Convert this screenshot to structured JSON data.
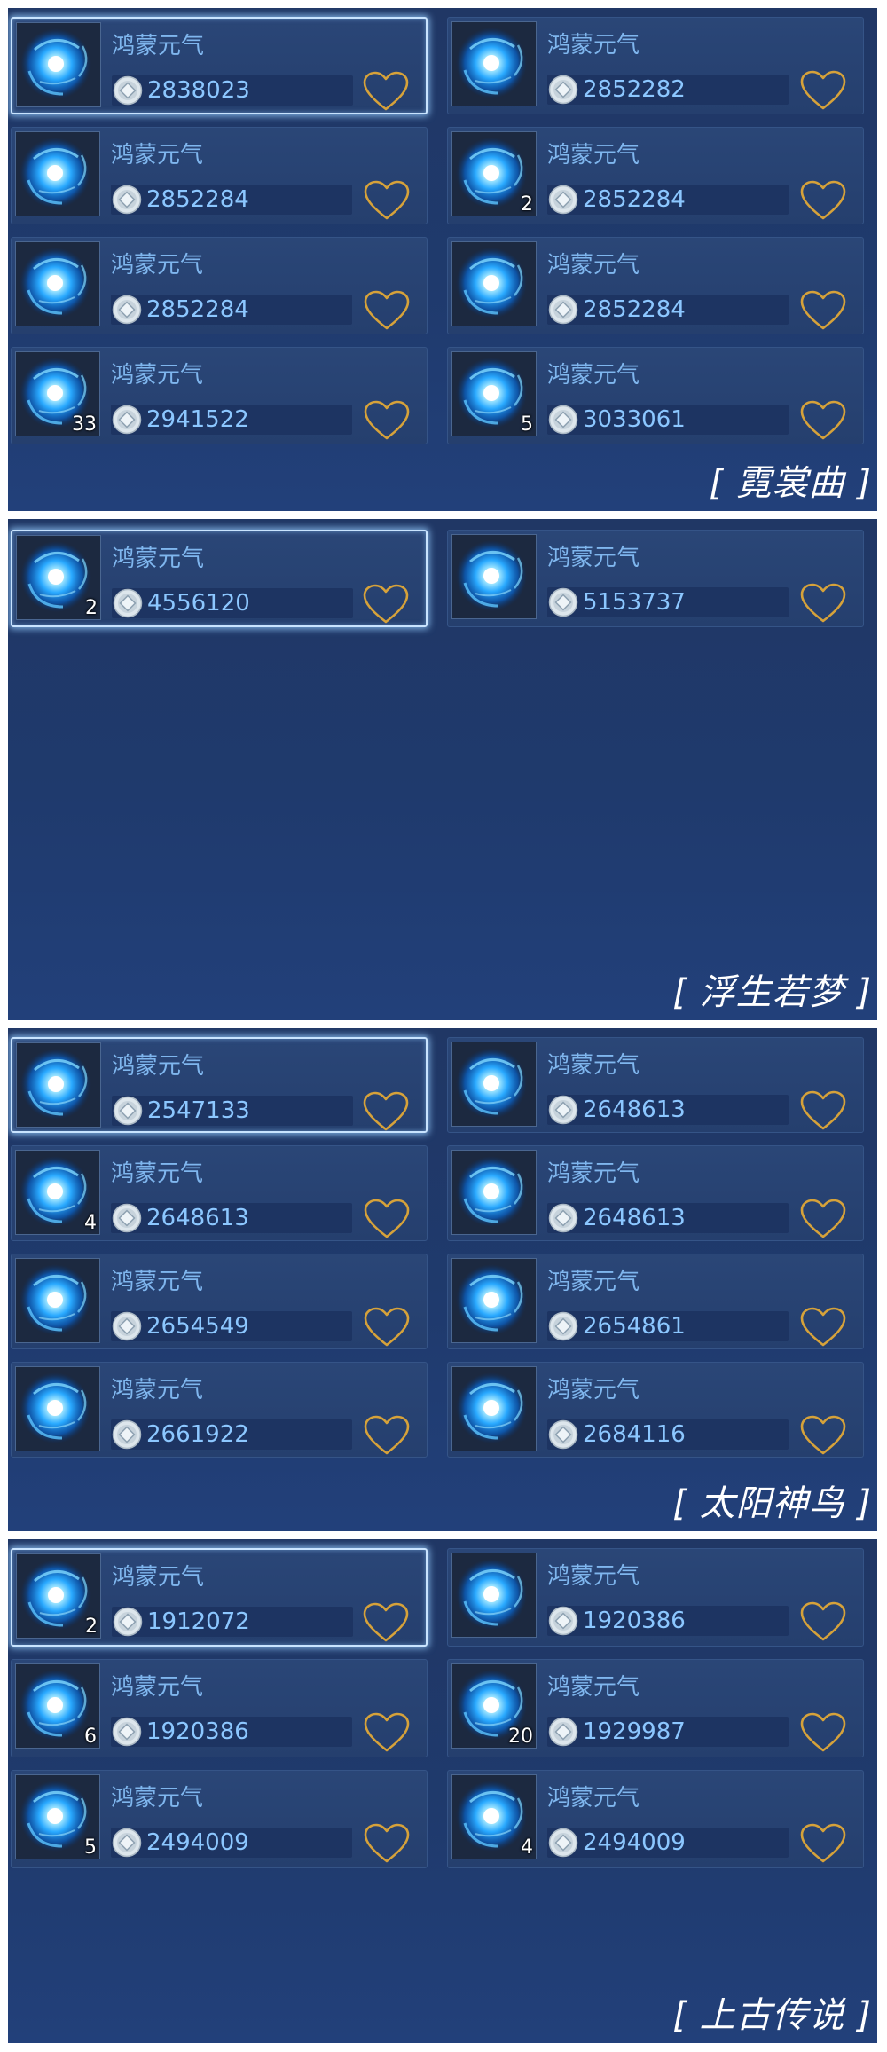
{
  "panels": [
    {
      "label": "[ 霓裳曲 ]",
      "items": [
        {
          "name": "鸿蒙元气",
          "price": "2838023",
          "count": "",
          "selected": true
        },
        {
          "name": "鸿蒙元气",
          "price": "2852282",
          "count": ""
        },
        {
          "name": "鸿蒙元气",
          "price": "2852284",
          "count": ""
        },
        {
          "name": "鸿蒙元气",
          "price": "2852284",
          "count": "2"
        },
        {
          "name": "鸿蒙元气",
          "price": "2852284",
          "count": ""
        },
        {
          "name": "鸿蒙元气",
          "price": "2852284",
          "count": ""
        },
        {
          "name": "鸿蒙元气",
          "price": "2941522",
          "count": "33"
        },
        {
          "name": "鸿蒙元气",
          "price": "3033061",
          "count": "5"
        }
      ]
    },
    {
      "label": "[ 浮生若梦 ]",
      "items": [
        {
          "name": "鸿蒙元气",
          "price": "4556120",
          "count": "2",
          "selected": true
        },
        {
          "name": "鸿蒙元气",
          "price": "5153737",
          "count": ""
        }
      ]
    },
    {
      "label": "[ 太阳神鸟 ]",
      "items": [
        {
          "name": "鸿蒙元气",
          "price": "2547133",
          "count": "",
          "selected": true
        },
        {
          "name": "鸿蒙元气",
          "price": "2648613",
          "count": ""
        },
        {
          "name": "鸿蒙元气",
          "price": "2648613",
          "count": "4"
        },
        {
          "name": "鸿蒙元气",
          "price": "2648613",
          "count": ""
        },
        {
          "name": "鸿蒙元气",
          "price": "2654549",
          "count": ""
        },
        {
          "name": "鸿蒙元气",
          "price": "2654861",
          "count": ""
        },
        {
          "name": "鸿蒙元气",
          "price": "2661922",
          "count": ""
        },
        {
          "name": "鸿蒙元气",
          "price": "2684116",
          "count": ""
        }
      ]
    },
    {
      "label": "[ 上古传说 ]",
      "items": [
        {
          "name": "鸿蒙元气",
          "price": "1912072",
          "count": "2",
          "selected": true
        },
        {
          "name": "鸿蒙元气",
          "price": "1920386",
          "count": ""
        },
        {
          "name": "鸿蒙元气",
          "price": "1920386",
          "count": "6"
        },
        {
          "name": "鸿蒙元气",
          "price": "1929987",
          "count": "20"
        },
        {
          "name": "鸿蒙元气",
          "price": "2494009",
          "count": "5"
        },
        {
          "name": "鸿蒙元气",
          "price": "2494009",
          "count": "4"
        }
      ]
    }
  ],
  "icons": {
    "item": "blue-vortex-orb-icon",
    "currency": "silver-coin-icon",
    "favorite": "heart-outline-icon"
  },
  "colors": {
    "panel_bg": "#1f3a6d",
    "item_name": "#7fb6ee",
    "price": "#8cc7ff",
    "heart": "#d6a23a",
    "selected_border": "#c9e4ff"
  }
}
